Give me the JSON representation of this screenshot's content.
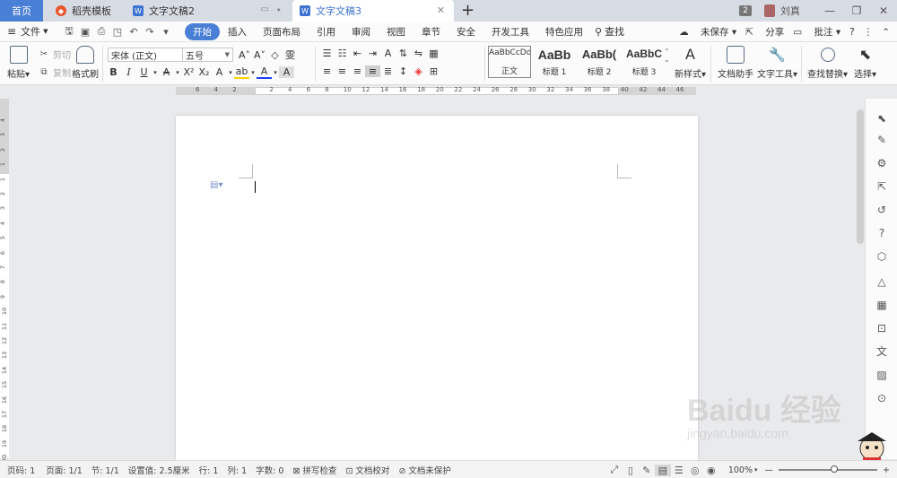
{
  "tabs": {
    "home": "首页",
    "template": "稻壳模板",
    "doc2": "文字文稿2",
    "doc3": "文字文稿3",
    "new": "+"
  },
  "titlebar_right": {
    "count": "2",
    "user": "刘真"
  },
  "menu": {
    "file": "文件",
    "items": [
      "开始",
      "插入",
      "页面布局",
      "引用",
      "审阅",
      "视图",
      "章节",
      "安全",
      "开发工具",
      "特色应用"
    ],
    "search": "查找",
    "right": [
      "未保存",
      "分享",
      "批注",
      "?"
    ]
  },
  "ribbon": {
    "paste": "粘贴",
    "cut": "剪切",
    "copy": "复制",
    "format_painter": "格式刷",
    "font_name": "宋体 (正文)",
    "font_size": "五号",
    "styles": [
      {
        "preview": "AaBbCcDd",
        "name": "正文"
      },
      {
        "preview": "AaBb",
        "name": "标题 1"
      },
      {
        "preview": "AaBb(",
        "name": "标题 2"
      },
      {
        "preview": "AaBbC",
        "name": "标题 3"
      }
    ],
    "new_style": "新样式",
    "doc_helper": "文档助手",
    "text_tools": "文字工具",
    "find_replace": "查找替换",
    "select": "选择"
  },
  "ruler_ticks": [
    "6",
    "4",
    "2",
    "",
    "2",
    "4",
    "6",
    "8",
    "10",
    "12",
    "14",
    "16",
    "18",
    "20",
    "22",
    "24",
    "26",
    "28",
    "30",
    "32",
    "34",
    "36",
    "38",
    "40",
    "42",
    "44",
    "46"
  ],
  "vruler_ticks": [
    "4",
    "3",
    "2",
    "1",
    "1",
    "2",
    "3",
    "4",
    "5",
    "6",
    "7",
    "8",
    "9",
    "10",
    "11",
    "12",
    "13",
    "14",
    "15",
    "16",
    "17",
    "18",
    "19",
    "20"
  ],
  "status": {
    "page_number": "页码: 1",
    "pages": "页面: 1/1",
    "section": "节: 1/1",
    "setting": "设置值: 2.5厘米",
    "row": "行: 1",
    "col": "列: 1",
    "word_count": "字数: 0",
    "spell_check": "拼写检查",
    "doc_proof": "文档校对",
    "doc_protect": "文档未保护",
    "zoom": "100%"
  },
  "watermark": {
    "logo": "Baidu 经验",
    "url": "jingyan.baidu.com"
  },
  "colors": {
    "accent": "#4a7fd6",
    "tabbar": "#d7dbe3"
  }
}
